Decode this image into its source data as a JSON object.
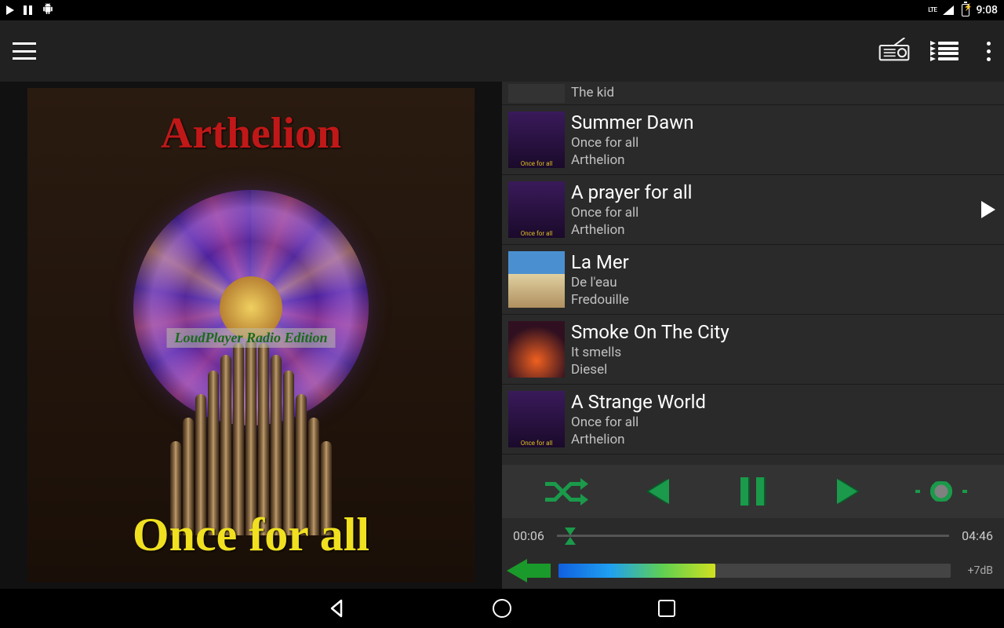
{
  "status": {
    "clock": "9:08",
    "net": "LTE"
  },
  "album_art": {
    "artist": "Arthelion",
    "album": "Once for all",
    "edition": "LoudPlayer Radio Edition"
  },
  "tracks": [
    {
      "title": "",
      "album": "",
      "artist": "The kid",
      "thumb": "generic",
      "partial": true,
      "playing": false
    },
    {
      "title": "Summer Dawn",
      "album": "Once for all",
      "artist": "Arthelion",
      "thumb": "organ",
      "playing": false
    },
    {
      "title": "A prayer for all",
      "album": "Once for all",
      "artist": "Arthelion",
      "thumb": "organ",
      "playing": true
    },
    {
      "title": "La Mer",
      "album": "De l'eau",
      "artist": "Fredouille",
      "thumb": "sea",
      "playing": false
    },
    {
      "title": "Smoke On The City",
      "album": "It smells",
      "artist": "Diesel",
      "thumb": "fire",
      "playing": false
    },
    {
      "title": "A Strange World",
      "album": "Once for all",
      "artist": "Arthelion",
      "thumb": "organ",
      "playing": false
    }
  ],
  "playback": {
    "elapsed": "00:06",
    "total": "04:46",
    "progress_pct": 2,
    "volume_pct": 40,
    "volume_db": "+7dB"
  }
}
